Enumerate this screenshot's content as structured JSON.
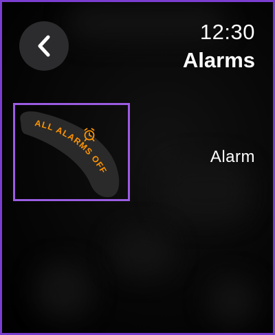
{
  "status": {
    "time": "12:30"
  },
  "header": {
    "title": "Alarms",
    "back_icon": "chevron-left-icon"
  },
  "complication": {
    "text": "ALL ALARMS OFF",
    "icon": "alarm-clock-icon"
  },
  "content": {
    "label": "Alarm"
  },
  "colors": {
    "accent_orange": "#ff9500",
    "highlight_purple": "#9b5de5",
    "button_bg": "#2c2c2e",
    "screen_bg": "#000000"
  }
}
